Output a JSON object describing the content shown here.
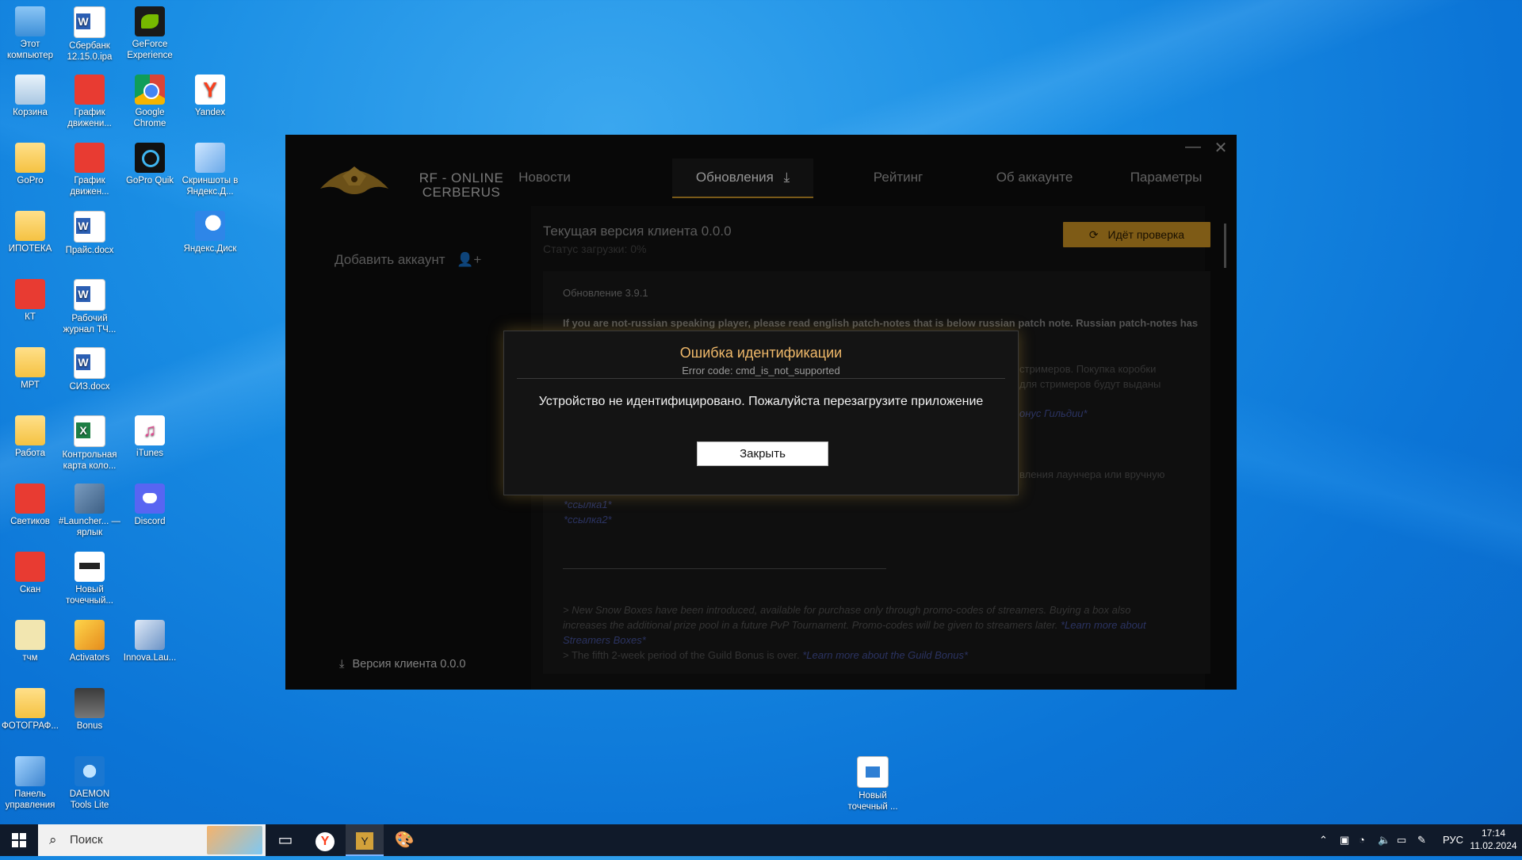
{
  "desktop": {
    "icons": [
      {
        "label": "Этот компьютер",
        "icon": "computer-icon"
      },
      {
        "label": "Сбербанк 12.15.0.ipa",
        "icon": "ipa-file-icon"
      },
      {
        "label": "GeForce Experience",
        "icon": "nvidia-icon"
      },
      {
        "label": "Корзина",
        "icon": "recycle-bin-icon"
      },
      {
        "label": "График движени...",
        "icon": "pdf-icon"
      },
      {
        "label": "Google Chrome",
        "icon": "chrome-icon"
      },
      {
        "label": "Yandex",
        "icon": "yandex-browser-icon"
      },
      {
        "label": "GoPro",
        "icon": "folder-icon"
      },
      {
        "label": "График движен...",
        "icon": "pdf-icon"
      },
      {
        "label": "GoPro Quik",
        "icon": "gopro-icon"
      },
      {
        "label": "Скриншоты в Яндекс.Д...",
        "icon": "screenshot-icon"
      },
      {
        "label": "ИПОТЕКА",
        "icon": "folder-icon"
      },
      {
        "label": "Прайс.docx",
        "icon": "word-icon"
      },
      {
        "label": "Яндекс.Диск",
        "icon": "yandex-disk-icon"
      },
      {
        "label": "КТ",
        "icon": "pdf-folder-icon"
      },
      {
        "label": "Рабочий журнал ТЧ...",
        "icon": "word-icon"
      },
      {
        "label": "МРТ",
        "icon": "folder-icon"
      },
      {
        "label": "СИЗ.docx",
        "icon": "word-icon"
      },
      {
        "label": "Работа",
        "icon": "folder-icon"
      },
      {
        "label": "Контрольная карта коло...",
        "icon": "excel-icon"
      },
      {
        "label": "iTunes",
        "icon": "itunes-icon"
      },
      {
        "label": "Светиков",
        "icon": "pdf-folder-icon"
      },
      {
        "label": "#Launcher... — ярлык",
        "icon": "launcher-shortcut-icon"
      },
      {
        "label": "Discord",
        "icon": "discord-icon"
      },
      {
        "label": "Скан",
        "icon": "pdf-folder-icon"
      },
      {
        "label": "Новый точечный...",
        "icon": "bitmap-icon"
      },
      {
        "label": "тчм",
        "icon": "folder-icon"
      },
      {
        "label": "Activators",
        "icon": "activators-icon"
      },
      {
        "label": "Innova.Lau...",
        "icon": "innova-icon"
      },
      {
        "label": "ФОТОГРАФ...",
        "icon": "folder-icon"
      },
      {
        "label": "Bonus",
        "icon": "bonus-icon"
      },
      {
        "label": "Панель управления",
        "icon": "control-panel-icon"
      },
      {
        "label": "DAEMON Tools Lite",
        "icon": "daemon-tools-icon"
      },
      {
        "label": "Новый точечный ...",
        "icon": "image-file-icon"
      }
    ]
  },
  "launcher": {
    "logo_text": "RF - ONLINE CERBERUS",
    "window_minimize": "—",
    "window_close": "✕",
    "nav": {
      "news": "Новости",
      "updates": "Обновления",
      "rating": "Рейтинг",
      "account": "Об аккаунте",
      "settings": "Параметры"
    },
    "sidebar": {
      "add_account": "Добавить аккаунт",
      "client_version": "Версия клиента 0.0.0"
    },
    "status": {
      "current_version": "Текущая версия клиента 0.0.0",
      "download_status": "Статус загрузки: 0%",
      "check_button": "Идёт проверка"
    },
    "notes": {
      "header": "Обновление 3.9.1",
      "intro": "If you are not-russian speaking player, please read english patch-notes that is below russian patch note. Russian patch-notes has",
      "ru_line1": "стримеров. Покупка коробки",
      "ru_line2": "для стримеров будут выданы",
      "ru_guild": "онус Гильдии*",
      "ru_launcher": "вления лаунчера или вручную",
      "link1": "*ссылка1*",
      "link2": "*ссылка2*",
      "en_line1": "> New Snow Boxes have been introduced, available for purchase only through promo-codes of streamers. Buying a box also",
      "en_line2": "increases the additional prize pool in a future PvP Tournament. Promo-codes will be given to streamers later.",
      "en_link1a": "*Learn more about",
      "en_link1b": "Streamers Boxes*",
      "en_line3": "> The fifth 2-week period of the Guild Bonus is over.",
      "en_link2": "*Learn more about the Guild Bonus*"
    },
    "modal": {
      "title": "Ошибка идентификации",
      "error_code": "Error code: cmd_is_not_supported",
      "message": "Устройство не идентифицировано. Пожалуйста перезагрузите приложение",
      "close_button": "Закрыть"
    }
  },
  "taskbar": {
    "search_placeholder": "Поиск",
    "language": "РУС",
    "time": "17:14",
    "date": "11.02.2024"
  },
  "colors": {
    "accent": "#d99d26",
    "modal_title": "#f0b96a",
    "desktop_blue": "#0b74d6"
  }
}
